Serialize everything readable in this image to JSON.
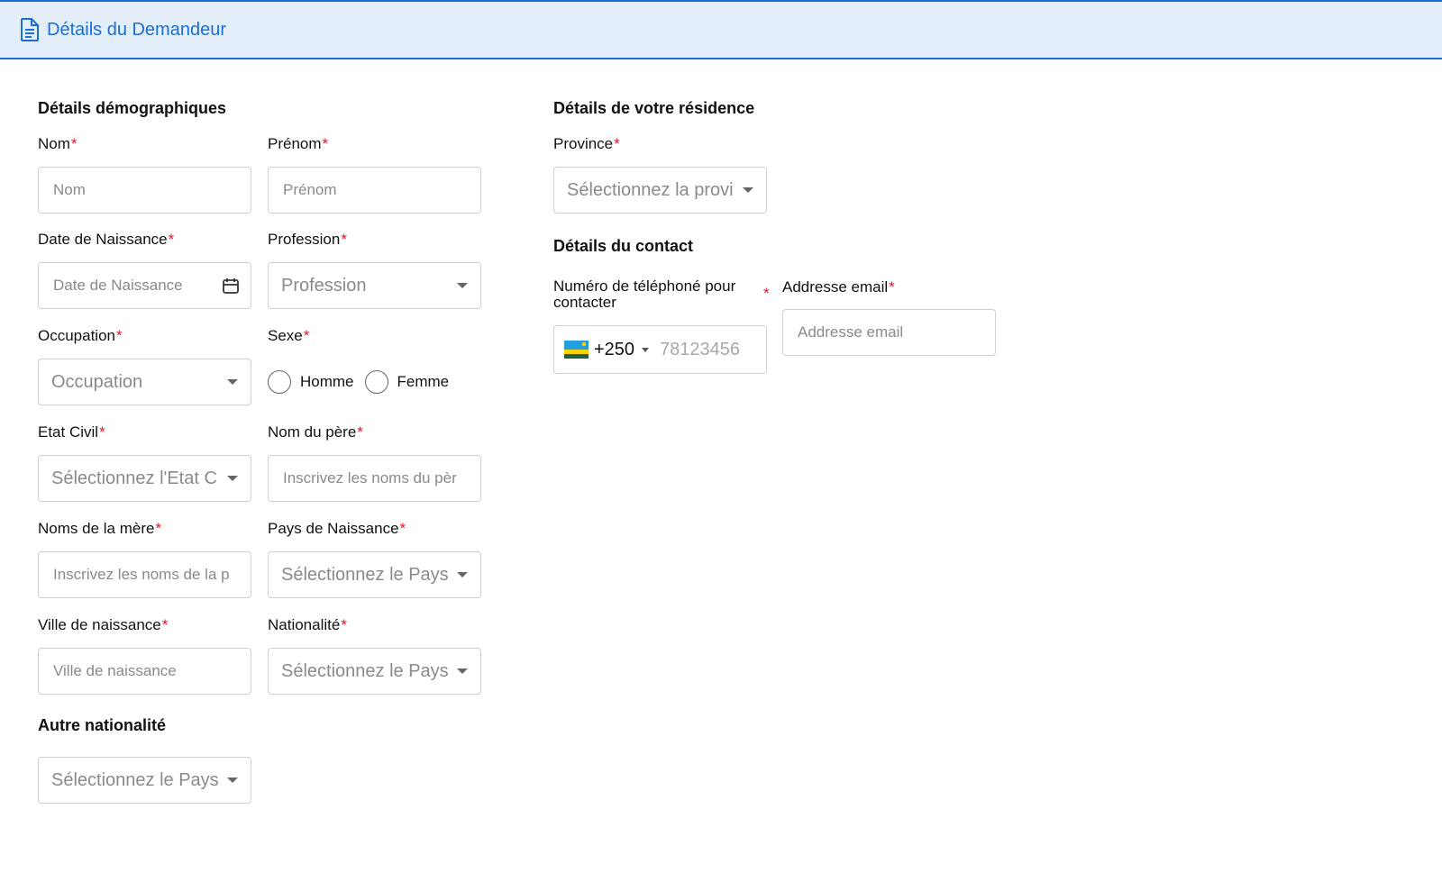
{
  "header": {
    "title": "Détails du Demandeur"
  },
  "demographics": {
    "title": "Détails démographiques",
    "nom": {
      "label": "Nom",
      "placeholder": "Nom"
    },
    "prenom": {
      "label": "Prénom",
      "placeholder": "Prénom"
    },
    "date_naissance": {
      "label": "Date de Naissance",
      "placeholder": "Date de Naissance"
    },
    "profession": {
      "label": "Profession",
      "placeholder": "Profession"
    },
    "occupation": {
      "label": "Occupation",
      "placeholder": "Occupation"
    },
    "sexe": {
      "label": "Sexe",
      "options": [
        "Homme",
        "Femme"
      ]
    },
    "etat_civil": {
      "label": "Etat Civil",
      "placeholder": "Sélectionnez l'Etat C"
    },
    "nom_pere": {
      "label": "Nom du père",
      "placeholder": "Inscrivez les noms du pèr"
    },
    "noms_mere": {
      "label": "Noms de la mère",
      "placeholder": "Inscrivez les noms de la p"
    },
    "pays_naissance": {
      "label": "Pays de Naissance",
      "placeholder": "Sélectionnez le Pays"
    },
    "ville_naissance": {
      "label": "Ville de naissance",
      "placeholder": "Ville de naissance"
    },
    "nationalite": {
      "label": "Nationalité",
      "placeholder": "Sélectionnez le Pays"
    }
  },
  "autre_nationalite": {
    "title": "Autre nationalité",
    "placeholder": "Sélectionnez le Pays"
  },
  "residence": {
    "title": "Détails de votre résidence",
    "province": {
      "label": "Province",
      "placeholder": "Sélectionnez la provi"
    }
  },
  "contact": {
    "title": "Détails du contact",
    "phone": {
      "label": "Numéro de téléphoné pour contacter",
      "dial_code": "+250",
      "placeholder": "78123456"
    },
    "email": {
      "label": "Addresse email",
      "placeholder": "Addresse email"
    }
  },
  "required_marker": "*",
  "colors": {
    "accent": "#1a6fd0",
    "header_bg": "#e4eef9",
    "required": "#e8102e"
  }
}
